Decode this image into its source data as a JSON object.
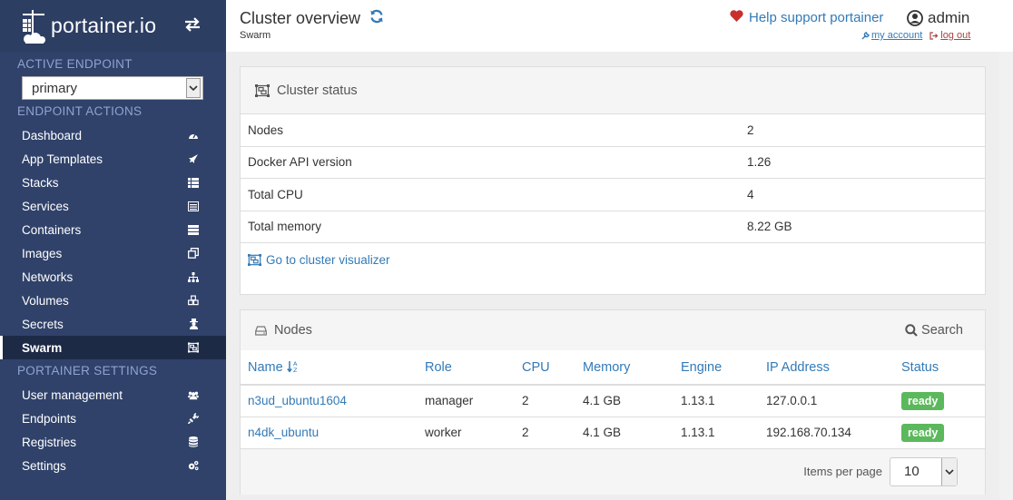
{
  "brand": {
    "name": "portainer.io"
  },
  "sidebar": {
    "active_endpoint_heading": "ACTIVE ENDPOINT",
    "endpoint_selected": "primary",
    "endpoint_actions_heading": "ENDPOINT ACTIONS",
    "items": [
      {
        "label": "Dashboard",
        "icon": "tachometer-icon"
      },
      {
        "label": "App Templates",
        "icon": "rocket-icon"
      },
      {
        "label": "Stacks",
        "icon": "th-list-icon"
      },
      {
        "label": "Services",
        "icon": "list-alt-icon"
      },
      {
        "label": "Containers",
        "icon": "server-icon"
      },
      {
        "label": "Images",
        "icon": "clone-icon"
      },
      {
        "label": "Networks",
        "icon": "sitemap-icon"
      },
      {
        "label": "Volumes",
        "icon": "cubes-icon"
      },
      {
        "label": "Secrets",
        "icon": "user-secret-icon"
      },
      {
        "label": "Swarm",
        "icon": "object-group-icon",
        "active": true
      }
    ],
    "settings_heading": "PORTAINER SETTINGS",
    "settings_items": [
      {
        "label": "User management",
        "icon": "users-icon"
      },
      {
        "label": "Endpoints",
        "icon": "plug-icon"
      },
      {
        "label": "Registries",
        "icon": "database-icon"
      },
      {
        "label": "Settings",
        "icon": "cogs-icon"
      }
    ]
  },
  "header": {
    "title": "Cluster overview",
    "subtitle": "Swarm",
    "help": "Help support portainer",
    "username": "admin",
    "my_account": "my account",
    "log_out": "log out"
  },
  "cluster_status": {
    "title": "Cluster status",
    "rows": [
      {
        "key": "Nodes",
        "value": "2"
      },
      {
        "key": "Docker API version",
        "value": "1.26"
      },
      {
        "key": "Total CPU",
        "value": "4"
      },
      {
        "key": "Total memory",
        "value": "8.22 GB"
      }
    ],
    "visualizer_link": "Go to cluster visualizer"
  },
  "nodes": {
    "title": "Nodes",
    "search_label": "Search",
    "columns": [
      "Name",
      "Role",
      "CPU",
      "Memory",
      "Engine",
      "IP Address",
      "Status"
    ],
    "rows": [
      {
        "name": "n3ud_ubuntu1604",
        "role": "manager",
        "cpu": "2",
        "memory": "4.1 GB",
        "engine": "1.13.1",
        "ip": "127.0.0.1",
        "status": "ready"
      },
      {
        "name": "n4dk_ubuntu",
        "role": "worker",
        "cpu": "2",
        "memory": "4.1 GB",
        "engine": "1.13.1",
        "ip": "192.168.70.134",
        "status": "ready"
      }
    ],
    "items_per_page_label": "Items per page",
    "items_per_page": "10"
  },
  "colors": {
    "sidebar_bg": "#30426a",
    "link": "#337ab7",
    "ready_badge": "#5cb85c",
    "heart": "#c9302c"
  }
}
